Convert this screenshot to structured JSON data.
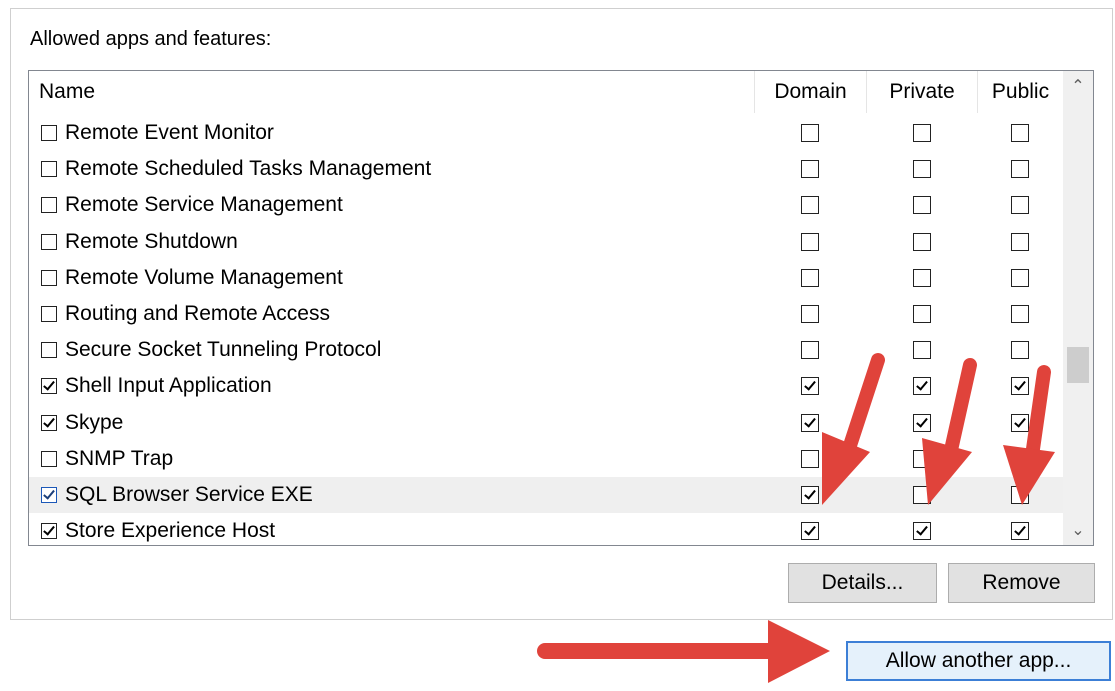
{
  "group_title": "Allowed apps and features:",
  "columns": {
    "name": "Name",
    "domain": "Domain",
    "private": "Private",
    "public": "Public"
  },
  "rows": [
    {
      "label": "Remote Event Monitor",
      "enabled": false,
      "domain": false,
      "private": false,
      "public": false
    },
    {
      "label": "Remote Scheduled Tasks Management",
      "enabled": false,
      "domain": false,
      "private": false,
      "public": false
    },
    {
      "label": "Remote Service Management",
      "enabled": false,
      "domain": false,
      "private": false,
      "public": false
    },
    {
      "label": "Remote Shutdown",
      "enabled": false,
      "domain": false,
      "private": false,
      "public": false
    },
    {
      "label": "Remote Volume Management",
      "enabled": false,
      "domain": false,
      "private": false,
      "public": false
    },
    {
      "label": "Routing and Remote Access",
      "enabled": false,
      "domain": false,
      "private": false,
      "public": false
    },
    {
      "label": "Secure Socket Tunneling Protocol",
      "enabled": false,
      "domain": false,
      "private": false,
      "public": false
    },
    {
      "label": "Shell Input Application",
      "enabled": true,
      "domain": true,
      "private": true,
      "public": true
    },
    {
      "label": "Skype",
      "enabled": true,
      "domain": true,
      "private": true,
      "public": true
    },
    {
      "label": "SNMP Trap",
      "enabled": false,
      "domain": false,
      "private": false,
      "public": false
    },
    {
      "label": "SQL Browser Service EXE",
      "enabled": true,
      "domain": true,
      "private": false,
      "public": false,
      "selected": true
    },
    {
      "label": "Store Experience Host",
      "enabled": true,
      "domain": true,
      "private": true,
      "public": true
    }
  ],
  "scrollbar": {
    "up_icon": "chevron-up-icon",
    "down_icon": "chevron-down-icon"
  },
  "buttons": {
    "details": "Details...",
    "remove": "Remove",
    "allow_another": "Allow another app..."
  },
  "colors": {
    "annotation_arrow": "#e0433b",
    "selected_row": "#efefef",
    "focus_border": "#3c7fd6"
  }
}
